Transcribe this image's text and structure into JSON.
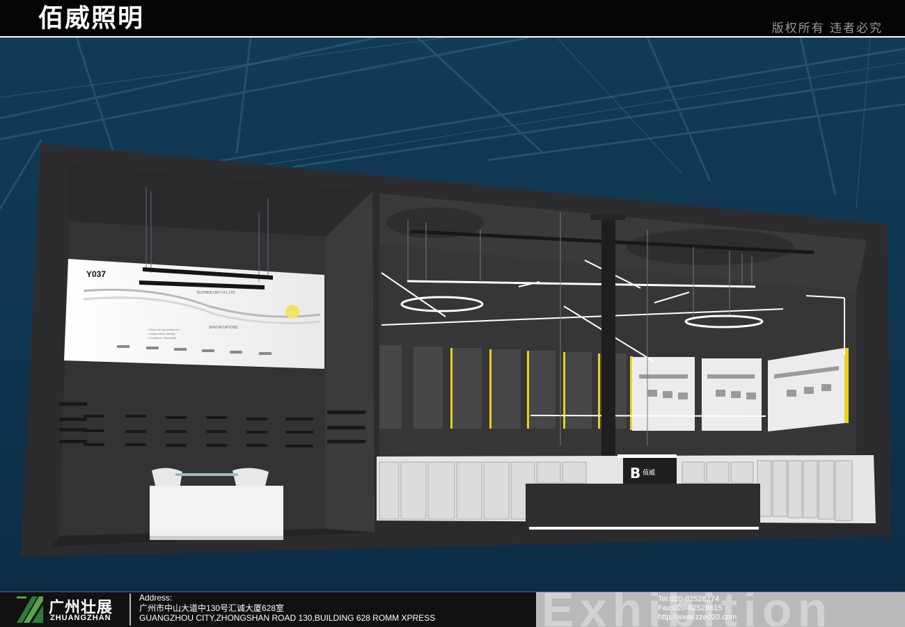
{
  "header": {
    "brand": "佰威照明",
    "copyright": "版权所有 违者必究"
  },
  "scene": {
    "screen_model": "Y037",
    "screen_company": "TECHNOLOGY CO.,LTD",
    "screen_spec": "SPECIFICATIONS",
    "screen_features": [
      "• Super strong waterproof",
      "• Independent visibility",
      "• Dustproof / Dimmable"
    ],
    "counter_logo": "佰威"
  },
  "footer": {
    "company_cn": "广州壮展",
    "company_en": "ZHUANGZHAN",
    "address_label": "Address:",
    "address_cn": "广州市中山大道中130号汇诚大厦628室",
    "address_en": "GUANGZHOU CITY,ZHONGSHAN ROAD 130,BUILDING 628 ROMM XPRESS",
    "watermark": "Exhibition",
    "tel": "Tel:020-82528274",
    "fax": "Fax:020-82528615",
    "web": "http://www.zze020.com"
  },
  "colors": {
    "background": "#0f3550",
    "booth": "#2c2c2e",
    "accent_yellow": "#e8d21a"
  }
}
